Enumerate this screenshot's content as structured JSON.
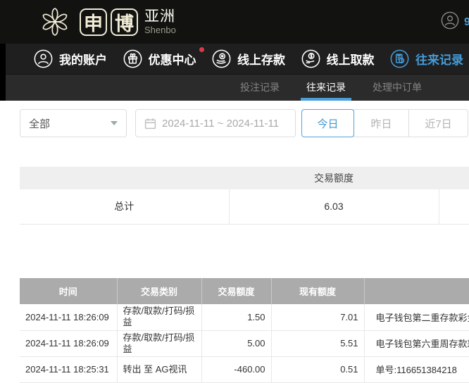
{
  "brand": {
    "box_char_1": "申",
    "box_char_2": "博",
    "region": "亚洲",
    "subtitle": "Shenbo"
  },
  "topbar": {
    "partial_username": "9"
  },
  "nav": {
    "items": [
      {
        "id": "my-account",
        "label": "我的账户",
        "icon": "user-icon",
        "active": false,
        "badge": false
      },
      {
        "id": "promotions",
        "label": "优惠中心",
        "icon": "gift-icon",
        "active": false,
        "badge": true
      },
      {
        "id": "deposit",
        "label": "线上存款",
        "icon": "deposit-icon",
        "active": false,
        "badge": false
      },
      {
        "id": "withdraw",
        "label": "线上取款",
        "icon": "withdraw-icon",
        "active": false,
        "badge": false
      },
      {
        "id": "records",
        "label": "往来记录",
        "icon": "records-icon",
        "active": true,
        "badge": false
      }
    ]
  },
  "tabs": [
    {
      "id": "betting-records",
      "label": "投注记录",
      "active": false
    },
    {
      "id": "transaction-records",
      "label": "往来记录",
      "active": true
    },
    {
      "id": "pending-orders",
      "label": "处理中订单",
      "active": false
    }
  ],
  "filters": {
    "category_value": "全部",
    "date_range": "2024-11-11 ~ 2024-11-11",
    "quick_buttons": [
      {
        "id": "today",
        "label": "今日",
        "active": true
      },
      {
        "id": "yesterday",
        "label": "昨日",
        "active": false
      },
      {
        "id": "last-7-days",
        "label": "近7日",
        "active": false
      }
    ]
  },
  "summary": {
    "col_header": "交易额度",
    "total_label": "总计",
    "total_value": "6.03"
  },
  "transactions": {
    "headers": [
      "时间",
      "交易类别",
      "交易额度",
      "现有额度",
      ""
    ],
    "rows": [
      {
        "time": "2024-11-11 18:26:09",
        "type": "存款/取款/打码/损益",
        "amount": "1.50",
        "balance": "7.01",
        "remark": "电子钱包第二重存款彩金"
      },
      {
        "time": "2024-11-11 18:26:09",
        "type": "存款/取款/打码/损益",
        "amount": "5.00",
        "balance": "5.51",
        "remark": "电子钱包第六重周存款彩金"
      },
      {
        "time": "2024-11-11 18:25:31",
        "type": "转出 至 AG视讯",
        "amount": "-460.00",
        "balance": "0.51",
        "remark": "单号:116651384218"
      }
    ]
  },
  "colors": {
    "accent_blue": "#4a9fd8",
    "badge_red": "#d93a4a",
    "table_header_gray": "#ababab"
  }
}
